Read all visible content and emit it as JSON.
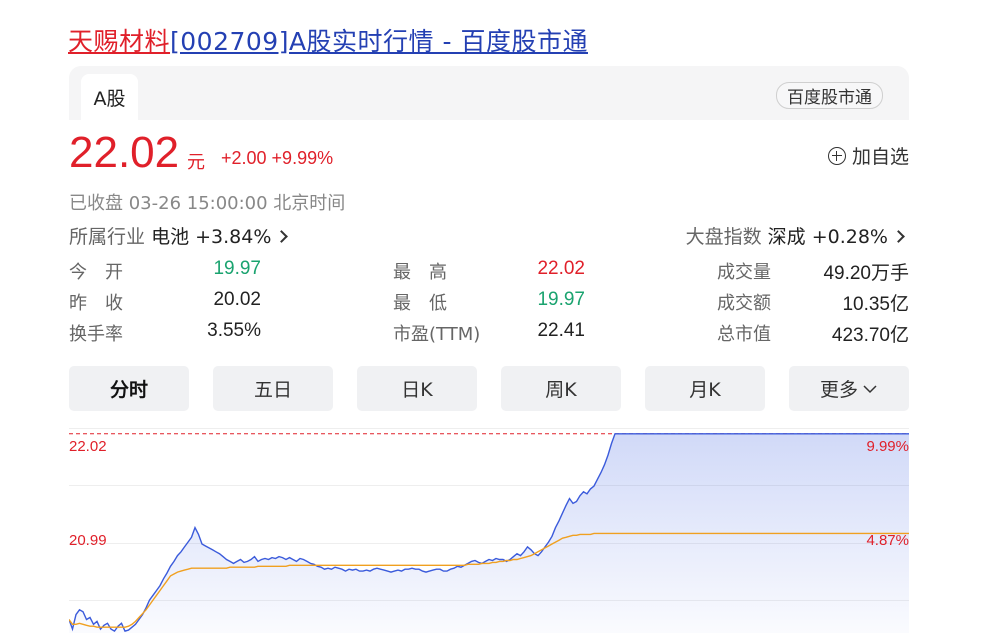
{
  "title": {
    "name": "天赐材料",
    "rest": "[002709]A股实时行情 - 百度股市通"
  },
  "tabs": {
    "active": "A股",
    "badge": "百度股市通"
  },
  "quote": {
    "price": "22.02",
    "unit": "元",
    "change": "+2.00 +9.99%",
    "status": "已收盘  03-26 15:00:00  北京时间",
    "add_watch": "加自选",
    "industry_label": "所属行业",
    "industry_value": "电池 +3.84%",
    "index_label": "大盘指数",
    "index_value": "深成 +0.28%"
  },
  "stats": [
    [
      {
        "label": "今　开",
        "value": "19.97",
        "color": "green"
      },
      {
        "label": "最　高",
        "value": "22.02",
        "color": "red"
      },
      {
        "label": "成交量",
        "value": "49.20万手",
        "color": "dark"
      }
    ],
    [
      {
        "label": "昨　收",
        "value": "20.02",
        "color": "dark"
      },
      {
        "label": "最　低",
        "value": "19.97",
        "color": "green"
      },
      {
        "label": "成交额",
        "value": "10.35亿",
        "color": "dark"
      }
    ],
    [
      {
        "label": "换手率",
        "value": "3.55%",
        "color": "dark"
      },
      {
        "label": "市盈(TTM)",
        "value": "22.41",
        "color": "dark"
      },
      {
        "label": "总市值",
        "value": "423.70亿",
        "color": "dark"
      }
    ]
  ],
  "period_tabs": [
    "分时",
    "五日",
    "日K",
    "周K",
    "月K",
    "更多"
  ],
  "chart": {
    "left_labels": [
      "22.02",
      "20.99"
    ],
    "right_labels": [
      "9.99%",
      "4.87%"
    ],
    "colors": {
      "price_line": "#3b5bdb",
      "avg_line": "#f0a020",
      "limit": "#e0202a"
    }
  },
  "chart_data": {
    "type": "line",
    "ylim": [
      19.96,
      22.08
    ],
    "x": [
      0,
      240
    ],
    "series": [
      {
        "values": [
          20.1,
          20.0,
          20.15,
          20.2,
          20.18,
          20.1,
          20.12,
          20.05,
          20.08,
          20.0,
          20.04,
          20.06,
          20.0,
          19.98,
          20.03,
          20.06,
          19.98,
          19.99,
          20.02,
          20.05,
          20.1,
          20.15,
          20.22,
          20.3,
          20.35,
          20.4,
          20.45,
          20.52,
          20.58,
          20.65,
          20.7,
          20.76,
          20.8,
          20.85,
          20.9,
          20.95,
          21.05,
          20.98,
          20.88,
          20.86,
          20.84,
          20.82,
          20.8,
          20.78,
          20.75,
          20.72,
          20.7,
          20.68,
          20.7,
          20.72,
          20.69,
          20.7,
          20.72,
          20.75,
          20.7,
          20.72,
          20.73,
          20.72,
          20.74,
          20.73,
          20.75,
          20.74,
          20.72,
          20.74,
          20.72,
          20.7,
          20.73,
          20.72,
          20.7,
          20.68,
          20.67,
          20.65,
          20.64,
          20.62,
          20.63,
          20.62,
          20.64,
          20.63,
          20.62,
          20.6,
          20.62,
          20.61,
          20.62,
          20.6,
          20.6,
          20.61,
          20.6,
          20.62,
          20.63,
          20.62,
          20.61,
          20.6,
          20.59,
          20.6,
          20.61,
          20.6,
          20.62,
          20.62,
          20.63,
          20.62,
          20.62,
          20.6,
          20.59,
          20.6,
          20.61,
          20.62,
          20.62,
          20.6,
          20.6,
          20.62,
          20.63,
          20.65,
          20.64,
          20.66,
          20.68,
          20.7,
          20.71,
          20.69,
          20.68,
          20.7,
          20.72,
          20.71,
          20.73,
          20.72,
          20.72,
          20.7,
          20.72,
          20.75,
          20.78,
          20.76,
          20.8,
          20.85,
          20.82,
          20.78,
          20.76,
          20.8,
          20.85,
          20.9,
          20.96,
          21.05,
          21.12,
          21.2,
          21.28,
          21.35,
          21.3,
          21.32,
          21.38,
          21.42,
          21.4,
          21.45,
          21.48,
          21.55,
          21.62,
          21.7,
          21.8,
          21.92,
          22.02,
          22.02,
          22.02,
          22.02,
          22.02,
          22.02,
          22.02,
          22.02,
          22.02,
          22.02,
          22.02,
          22.02,
          22.02,
          22.02,
          22.02,
          22.02,
          22.02,
          22.02,
          22.02,
          22.02,
          22.02,
          22.02,
          22.02,
          22.02,
          22.02,
          22.02,
          22.02,
          22.02,
          22.02,
          22.02,
          22.02,
          22.02,
          22.02,
          22.02,
          22.02,
          22.02,
          22.02,
          22.02,
          22.02,
          22.02,
          22.02,
          22.02,
          22.02,
          22.02,
          22.02,
          22.02,
          22.02,
          22.02,
          22.02,
          22.02,
          22.02,
          22.02,
          22.02,
          22.02,
          22.02,
          22.02,
          22.02,
          22.02,
          22.02,
          22.02,
          22.02,
          22.02,
          22.02,
          22.02,
          22.02,
          22.02,
          22.02,
          22.02,
          22.02,
          22.02,
          22.02,
          22.02,
          22.02,
          22.02,
          22.02,
          22.02,
          22.02,
          22.02,
          22.02,
          22.02,
          22.02,
          22.02,
          22.02,
          22.02,
          22.02,
          22.02,
          22.02,
          22.02,
          22.02,
          22.02,
          22.02
        ]
      },
      {
        "values": [
          20.1,
          20.05,
          20.05,
          20.06,
          20.05,
          20.04,
          20.03,
          20.03,
          20.02,
          20.02,
          20.02,
          20.02,
          20.02,
          20.02,
          20.02,
          20.02,
          20.02,
          20.03,
          20.05,
          20.08,
          20.12,
          20.16,
          20.2,
          20.25,
          20.3,
          20.35,
          20.4,
          20.45,
          20.5,
          20.55,
          20.57,
          20.59,
          20.6,
          20.61,
          20.62,
          20.63,
          20.63,
          20.63,
          20.63,
          20.63,
          20.63,
          20.63,
          20.63,
          20.63,
          20.63,
          20.63,
          20.64,
          20.64,
          20.64,
          20.64,
          20.64,
          20.64,
          20.64,
          20.64,
          20.65,
          20.65,
          20.65,
          20.65,
          20.65,
          20.65,
          20.65,
          20.65,
          20.65,
          20.66,
          20.66,
          20.66,
          20.66,
          20.66,
          20.66,
          20.66,
          20.66,
          20.66,
          20.66,
          20.66,
          20.66,
          20.66,
          20.66,
          20.66,
          20.66,
          20.66,
          20.66,
          20.66,
          20.66,
          20.66,
          20.66,
          20.66,
          20.66,
          20.66,
          20.66,
          20.66,
          20.66,
          20.66,
          20.66,
          20.66,
          20.66,
          20.66,
          20.66,
          20.66,
          20.66,
          20.66,
          20.66,
          20.66,
          20.66,
          20.66,
          20.66,
          20.66,
          20.66,
          20.66,
          20.66,
          20.66,
          20.66,
          20.66,
          20.66,
          20.66,
          20.67,
          20.67,
          20.67,
          20.67,
          20.68,
          20.68,
          20.68,
          20.69,
          20.69,
          20.7,
          20.7,
          20.71,
          20.71,
          20.72,
          20.72,
          20.73,
          20.74,
          20.75,
          20.76,
          20.78,
          20.8,
          20.82,
          20.84,
          20.86,
          20.88,
          20.9,
          20.92,
          20.94,
          20.95,
          20.96,
          20.97,
          20.97,
          20.98,
          20.98,
          20.98,
          20.98,
          20.99,
          20.99,
          20.99,
          20.99,
          20.99,
          20.99,
          20.99,
          20.99,
          20.99,
          20.99,
          20.99,
          20.99,
          20.99,
          20.99,
          20.99,
          20.99,
          20.99,
          20.99,
          20.99,
          20.99,
          20.99,
          20.99,
          20.99,
          20.99,
          20.99,
          20.99,
          20.99,
          20.99,
          20.99,
          20.99,
          20.99,
          20.99,
          20.99,
          20.99,
          20.99,
          20.99,
          20.99,
          20.99,
          20.99,
          20.99,
          20.99,
          20.99,
          20.99,
          20.99,
          20.99,
          20.99,
          20.99,
          20.99,
          20.99,
          20.99,
          20.99,
          20.99,
          20.99,
          20.99,
          20.99,
          20.99,
          20.99,
          20.99,
          20.99,
          20.99,
          20.99,
          20.99,
          20.99,
          20.99,
          20.99,
          20.99,
          20.99,
          20.99,
          20.99,
          20.99,
          20.99,
          20.99,
          20.99,
          20.99,
          20.99,
          20.99,
          20.99,
          20.99,
          20.99,
          20.99,
          20.99,
          20.99,
          20.99,
          20.99,
          20.99,
          20.99,
          20.99,
          20.99,
          20.99,
          20.99,
          20.99,
          20.99,
          20.99,
          20.99,
          20.99,
          20.99,
          20.99,
          20.99
        ]
      }
    ],
    "reference_lines": [
      22.02,
      20.99
    ],
    "ytick_labels": [
      "22.02",
      "20.99"
    ],
    "y2tick_labels": [
      "9.99%",
      "4.87%"
    ],
    "grid": true
  }
}
